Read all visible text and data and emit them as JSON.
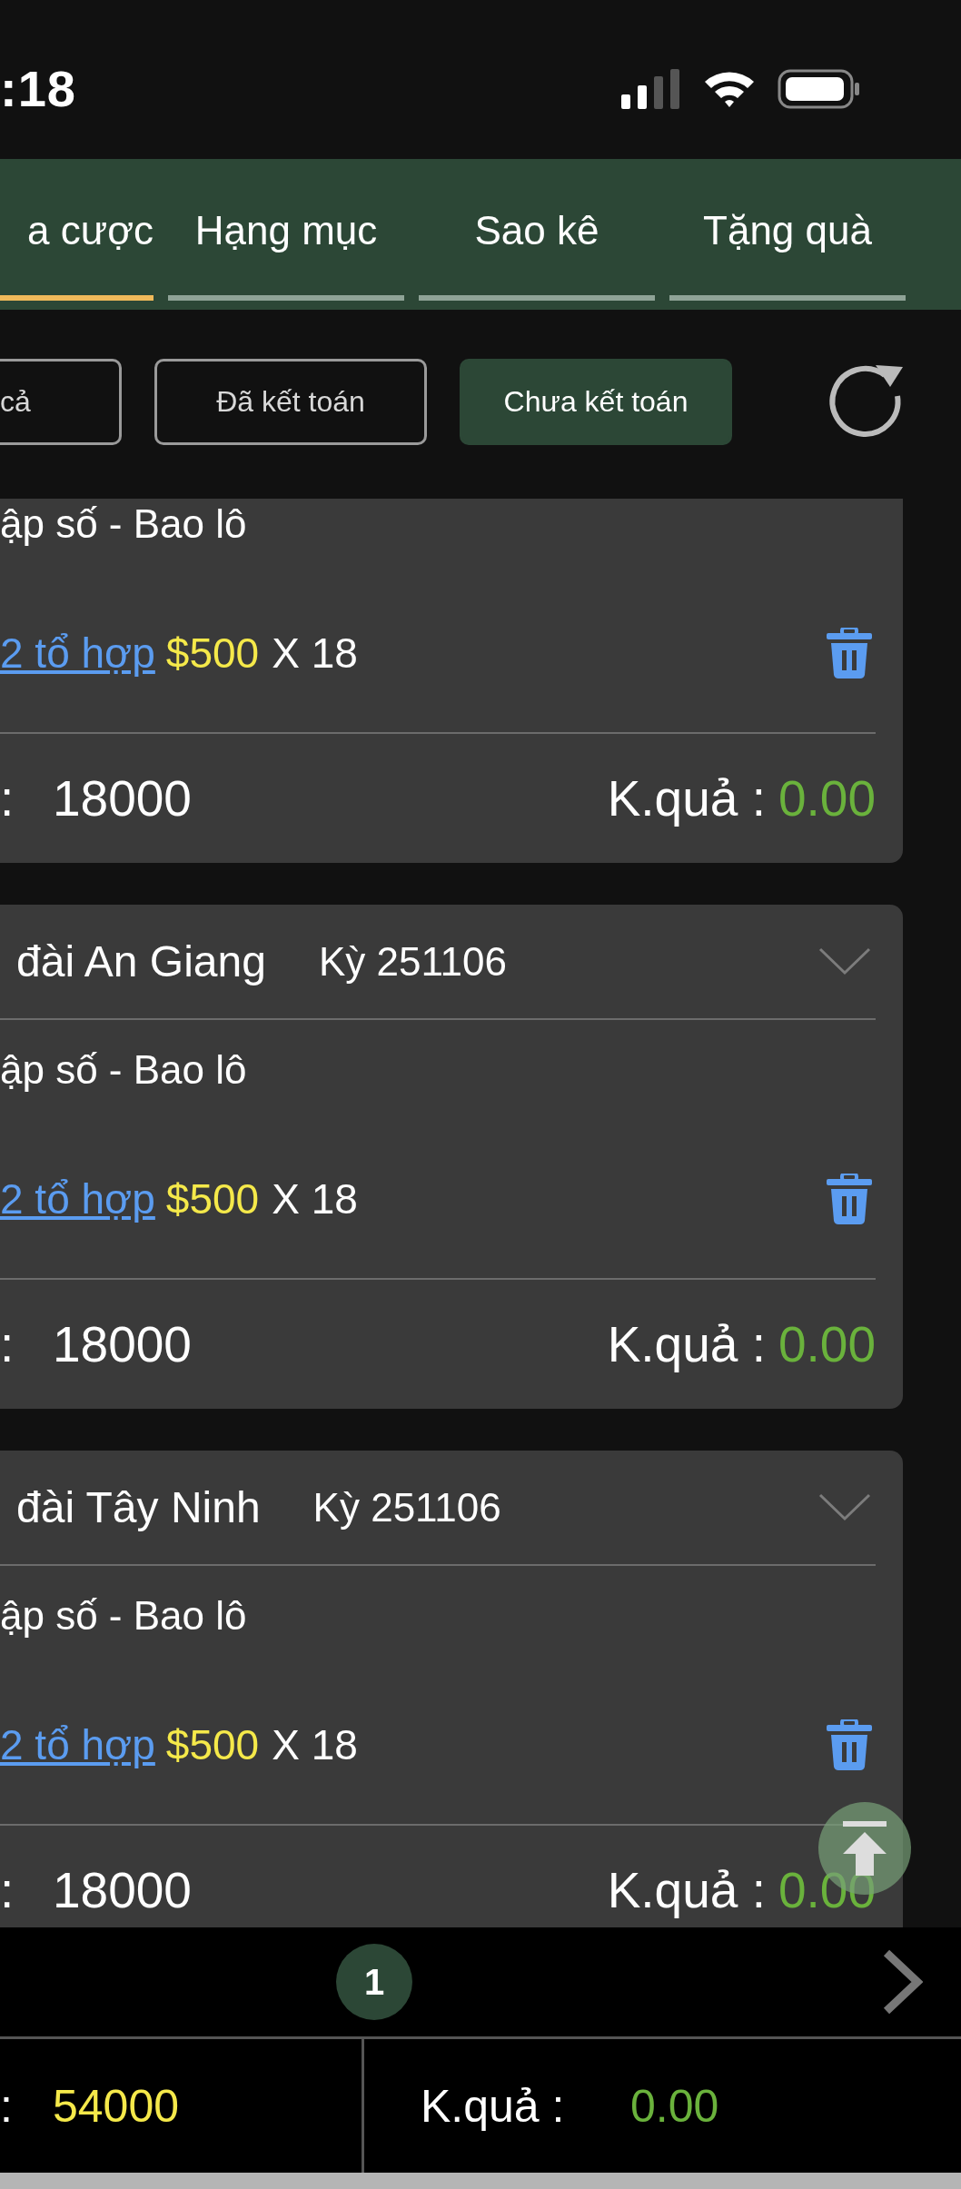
{
  "status_bar": {
    "time": ":18"
  },
  "tabs": [
    {
      "label": "a cược",
      "selected": true
    },
    {
      "label": "Hạng mục",
      "selected": false
    },
    {
      "label": "Sao kê",
      "selected": false
    },
    {
      "label": "Tặng quà",
      "selected": false
    }
  ],
  "filters": [
    {
      "label": "cả",
      "selected": false
    },
    {
      "label": "Đã kết toán",
      "selected": false
    },
    {
      "label": "Chưa kết toán",
      "selected": true
    }
  ],
  "bets": [
    {
      "play": "ập số - Bao lô",
      "combo": "2 tổ hợp",
      "stake": "$500",
      "multiplier": "X 18",
      "amount_label": ":",
      "amount": "18000",
      "result_label": "K.quả :",
      "result": "0.00"
    },
    {
      "station": "đài An Giang",
      "period": "Kỳ 251106",
      "play": "ập số - Bao lô",
      "combo": "2 tổ hợp",
      "stake": "$500",
      "multiplier": "X 18",
      "amount_label": ":",
      "amount": "18000",
      "result_label": "K.quả :",
      "result": "0.00"
    },
    {
      "station": "đài Tây Ninh",
      "period": "Kỳ 251106",
      "play": "ập số - Bao lô",
      "combo": "2 tổ hợp",
      "stake": "$500",
      "multiplier": "X 18",
      "amount_label": ":",
      "amount": "18000",
      "result_label": "K.quả :",
      "result": "0.00"
    }
  ],
  "pagination": {
    "pages": [
      {
        "label": "1",
        "selected": true
      }
    ]
  },
  "summary": {
    "total_label": ":",
    "total": "54000",
    "result_label": "K.quả :",
    "result": "0.00"
  }
}
